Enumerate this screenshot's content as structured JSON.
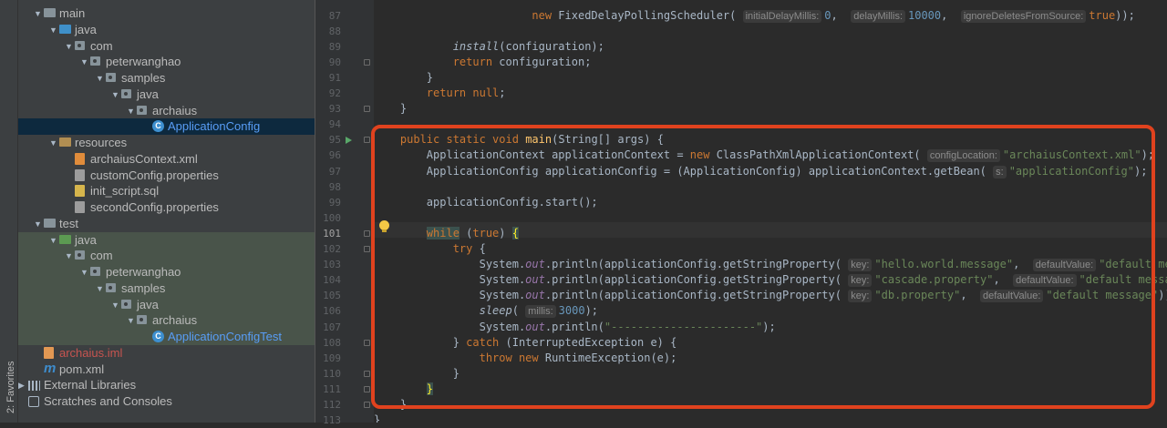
{
  "sidebar": {
    "favorites_label": "2: Favorites"
  },
  "tree": [
    {
      "label": "main",
      "level": 1,
      "arrow": "open",
      "icon": "folder-grey"
    },
    {
      "label": "java",
      "level": 2,
      "arrow": "open",
      "icon": "folder-blue"
    },
    {
      "label": "com",
      "level": 3,
      "arrow": "open",
      "icon": "package"
    },
    {
      "label": "peterwanghao",
      "level": 4,
      "arrow": "open",
      "icon": "package"
    },
    {
      "label": "samples",
      "level": 5,
      "arrow": "open",
      "icon": "package"
    },
    {
      "label": "java",
      "level": 6,
      "arrow": "open",
      "icon": "package"
    },
    {
      "label": "archaius",
      "level": 7,
      "arrow": "open",
      "icon": "package"
    },
    {
      "label": "ApplicationConfig",
      "level": 8,
      "arrow": "none",
      "icon": "class",
      "selected": true
    },
    {
      "label": "resources",
      "level": 2,
      "arrow": "open",
      "icon": "folder-brown"
    },
    {
      "label": "archaiusContext.xml",
      "level": 3,
      "arrow": "none",
      "icon": "file-xml"
    },
    {
      "label": "customConfig.properties",
      "level": 3,
      "arrow": "none",
      "icon": "file-prop"
    },
    {
      "label": "init_script.sql",
      "level": 3,
      "arrow": "none",
      "icon": "file-sql"
    },
    {
      "label": "secondConfig.properties",
      "level": 3,
      "arrow": "none",
      "icon": "file-prop"
    },
    {
      "label": "test",
      "level": 1,
      "arrow": "open",
      "icon": "folder-grey"
    },
    {
      "label": "java",
      "level": 2,
      "arrow": "open",
      "icon": "folder-green",
      "test": true
    },
    {
      "label": "com",
      "level": 3,
      "arrow": "open",
      "icon": "package",
      "test": true
    },
    {
      "label": "peterwanghao",
      "level": 4,
      "arrow": "open",
      "icon": "package",
      "test": true
    },
    {
      "label": "samples",
      "level": 5,
      "arrow": "open",
      "icon": "package",
      "test": true
    },
    {
      "label": "java",
      "level": 6,
      "arrow": "open",
      "icon": "package",
      "test": true
    },
    {
      "label": "archaius",
      "level": 7,
      "arrow": "open",
      "icon": "package",
      "test": true
    },
    {
      "label": "ApplicationConfigTest",
      "level": 8,
      "arrow": "none",
      "icon": "class",
      "test": true
    },
    {
      "label": "archaius.iml",
      "level": 1,
      "arrow": "none",
      "icon": "file-iml",
      "style": "red"
    },
    {
      "label": "pom.xml",
      "level": 1,
      "arrow": "none",
      "icon": "maven"
    },
    {
      "label": "External Libraries",
      "level": 0,
      "arrow": "closed",
      "icon": "libraries"
    },
    {
      "label": "Scratches and Consoles",
      "level": 0,
      "arrow": "none",
      "icon": "scratches"
    }
  ],
  "editor": {
    "current_line": 101,
    "lines": [
      {
        "n": 87,
        "html": "                        <span class=\"kw\">new</span> FixedDelayPollingScheduler( <span class=\"hint\">initialDelayMillis:</span><span class=\"nm\">0</span>,  <span class=\"hint\">delayMillis:</span><span class=\"nm\">10000</span>,  <span class=\"hint\">ignoreDeletesFromSource:</span><span class=\"kw\">true</span>));"
      },
      {
        "n": 88,
        "html": ""
      },
      {
        "n": 89,
        "html": "            <span class=\"it\">install</span>(configuration);"
      },
      {
        "n": 90,
        "html": "            <span class=\"kw\">return</span> configuration;"
      },
      {
        "n": 91,
        "html": "        }"
      },
      {
        "n": 92,
        "html": "        <span class=\"kw\">return null</span>;"
      },
      {
        "n": 93,
        "html": "    }"
      },
      {
        "n": 94,
        "html": ""
      },
      {
        "n": 95,
        "html": "    <span class=\"kw\">public static void</span> <span class=\"fn\">main</span>(String[] args) {"
      },
      {
        "n": 96,
        "html": "        ApplicationContext applicationContext = <span class=\"kw\">new</span> ClassPathXmlApplicationContext( <span class=\"hint\">configLocation:</span><span class=\"st\">\"archaiusContext.xml\"</span>);"
      },
      {
        "n": 97,
        "html": "        ApplicationConfig applicationConfig = (ApplicationConfig) applicationContext.getBean( <span class=\"hint\">s:</span><span class=\"st\">\"applicationConfig\"</span>);"
      },
      {
        "n": 98,
        "html": ""
      },
      {
        "n": 99,
        "html": "        applicationConfig.start();"
      },
      {
        "n": 100,
        "html": ""
      },
      {
        "n": 101,
        "html": "        <span class=\"kw hl-while\">while</span> (<span class=\"kw\">true</span>) <span class=\"brace-hl\">{</span>"
      },
      {
        "n": 102,
        "html": "            <span class=\"kw\">try</span> {"
      },
      {
        "n": 103,
        "html": "                System.<span class=\"fld\">out</span>.println(applicationConfig.getStringProperty( <span class=\"hint\">key:</span><span class=\"st\">\"hello.world.message\"</span>,  <span class=\"hint\">defaultValue:</span><span class=\"st\">\"default message\"</span>));"
      },
      {
        "n": 104,
        "html": "                System.<span class=\"fld\">out</span>.println(applicationConfig.getStringProperty( <span class=\"hint\">key:</span><span class=\"st\">\"cascade.property\"</span>,  <span class=\"hint\">defaultValue:</span><span class=\"st\">\"default message\"</span>));"
      },
      {
        "n": 105,
        "html": "                System.<span class=\"fld\">out</span>.println(applicationConfig.getStringProperty( <span class=\"hint\">key:</span><span class=\"st\">\"db.property\"</span>,  <span class=\"hint\">defaultValue:</span><span class=\"st\">\"default message\"</span>));"
      },
      {
        "n": 106,
        "html": "                <span class=\"it\">sleep</span>( <span class=\"hint\">millis:</span><span class=\"nm\">3000</span>);"
      },
      {
        "n": 107,
        "html": "                System.<span class=\"fld\">out</span>.println(<span class=\"st\">\"----------------------\"</span>);"
      },
      {
        "n": 108,
        "html": "            } <span class=\"kw\">catch</span> (InterruptedException e) {"
      },
      {
        "n": 109,
        "html": "                <span class=\"kw\">throw new</span> RuntimeException(e);"
      },
      {
        "n": 110,
        "html": "            }"
      },
      {
        "n": 111,
        "html": "        <span class=\"brace-hl\">}</span>"
      },
      {
        "n": 112,
        "html": "    }"
      },
      {
        "n": 113,
        "html": "}"
      }
    ]
  }
}
